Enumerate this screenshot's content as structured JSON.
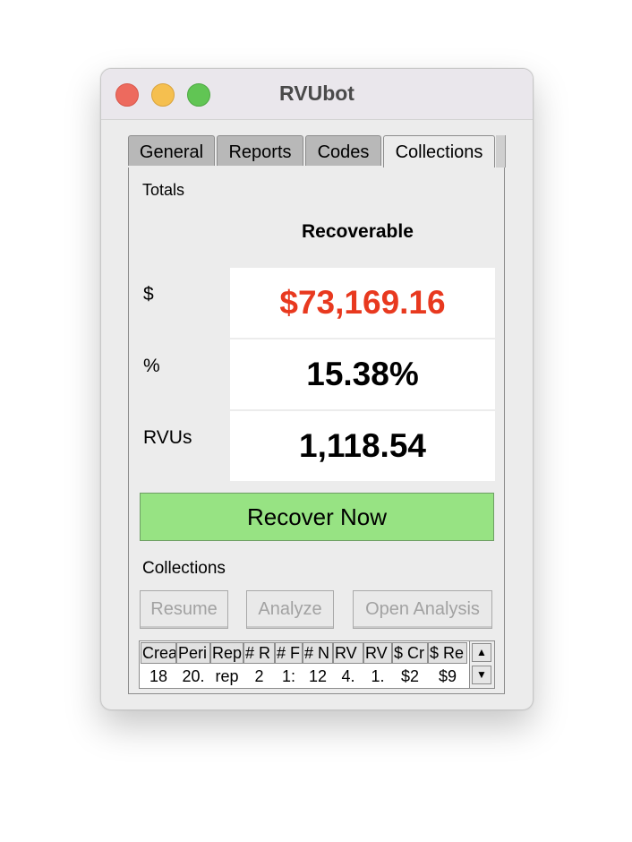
{
  "window": {
    "title": "RVUbot"
  },
  "tabs": [
    {
      "label": "General"
    },
    {
      "label": "Reports"
    },
    {
      "label": "Codes"
    },
    {
      "label": "Collections",
      "active": true
    }
  ],
  "totals": {
    "section_label": "Totals",
    "column_header": "Recoverable",
    "rows": [
      {
        "label": "$",
        "value": "$73,169.16",
        "color": "#e8391f"
      },
      {
        "label": "%",
        "value": "15.38%",
        "color": "#000000"
      },
      {
        "label": "RVUs",
        "value": "1,118.54",
        "color": "#000000"
      }
    ]
  },
  "recover_button": {
    "label": "Recover Now",
    "color": "#97e383"
  },
  "collections": {
    "section_label": "Collections",
    "buttons": [
      {
        "label": "Resume",
        "enabled": false
      },
      {
        "label": "Analyze",
        "enabled": false
      },
      {
        "label": "Open Analysis",
        "enabled": false
      }
    ],
    "table": {
      "headers": [
        "Crea",
        "Peri",
        "Rep",
        "# R",
        "# F",
        "# N",
        "RV",
        "RV",
        "$ Cr",
        "$ Re"
      ],
      "row": [
        "18",
        "20.",
        "rep",
        "2",
        "1:",
        "12",
        "4.",
        "1.",
        "$2",
        "$9"
      ]
    }
  }
}
